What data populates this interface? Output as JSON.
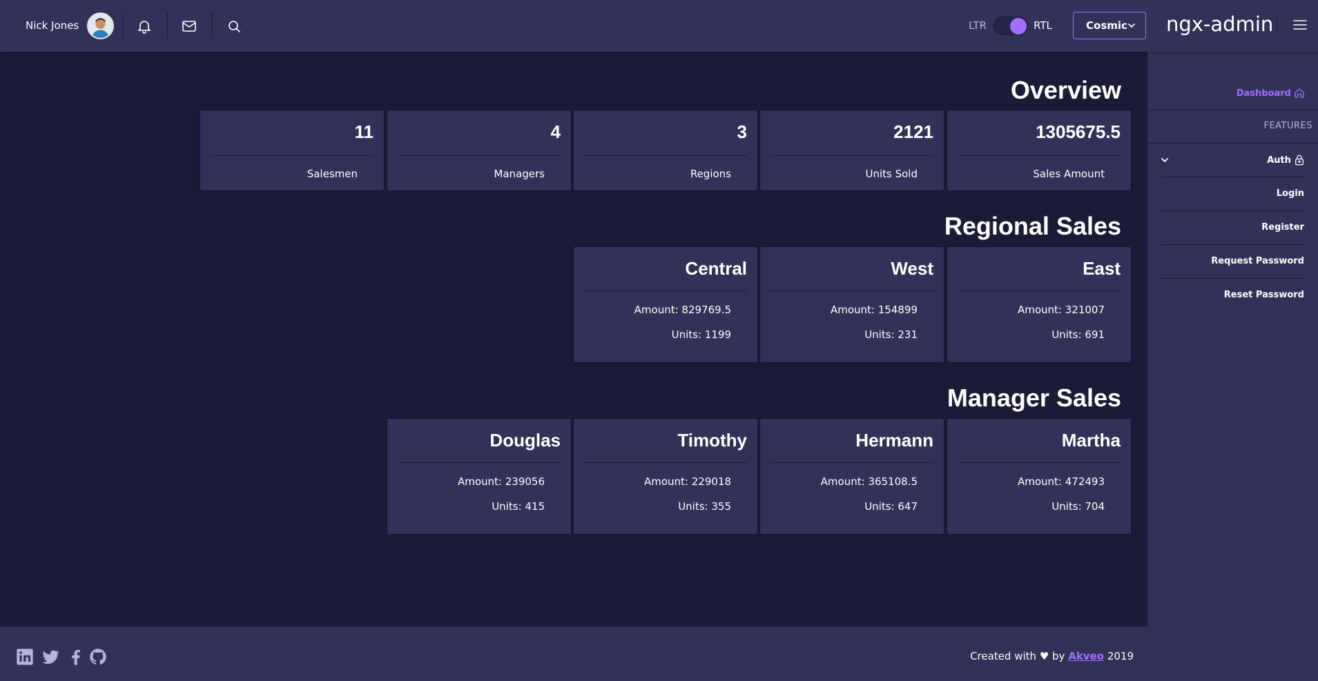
{
  "header": {
    "user_name": "Nick Jones",
    "direction_ltr": "LTR",
    "direction_rtl": "RTL",
    "direction_selected": "RTL",
    "theme": "Cosmic",
    "brand": "ngx-admin"
  },
  "sidebar": {
    "dashboard": "Dashboard",
    "features_group": "FEATURES",
    "auth": "Auth",
    "auth_items": [
      "Login",
      "Register",
      "Request Password",
      "Reset Password"
    ]
  },
  "overview": {
    "title": "Overview",
    "stats": [
      {
        "value": "11",
        "label": "Salesmen"
      },
      {
        "value": "4",
        "label": "Managers"
      },
      {
        "value": "3",
        "label": "Regions"
      },
      {
        "value": "2121",
        "label": "Units Sold"
      },
      {
        "value": "1305675.5",
        "label": "Sales Amount"
      }
    ]
  },
  "regional": {
    "title": "Regional Sales",
    "regions": [
      {
        "name": "Central",
        "amount": "Amount: 829769.5",
        "units": "Units: 1199"
      },
      {
        "name": "West",
        "amount": "Amount: 154899",
        "units": "Units: 231"
      },
      {
        "name": "East",
        "amount": "Amount: 321007",
        "units": "Units: 691"
      }
    ]
  },
  "managers": {
    "title": "Manager Sales",
    "people": [
      {
        "name": "Douglas",
        "amount": "Amount: 239056",
        "units": "Units: 415"
      },
      {
        "name": "Timothy",
        "amount": "Amount: 229018",
        "units": "Units: 355"
      },
      {
        "name": "Hermann",
        "amount": "Amount: 365108.5",
        "units": "Units: 647"
      },
      {
        "name": "Martha",
        "amount": "Amount: 472493",
        "units": "Units: 704"
      }
    ]
  },
  "footer": {
    "created_with": "Created with ♥ by",
    "company": "Akveo",
    "year": "2019",
    "social_icons": [
      "linkedin-icon",
      "twitter-icon",
      "facebook-icon",
      "github-icon"
    ]
  },
  "colors": {
    "background": "#1b1b38",
    "surface": "#323259",
    "accent": "#a16eff",
    "muted_text": "#b4b4db"
  }
}
